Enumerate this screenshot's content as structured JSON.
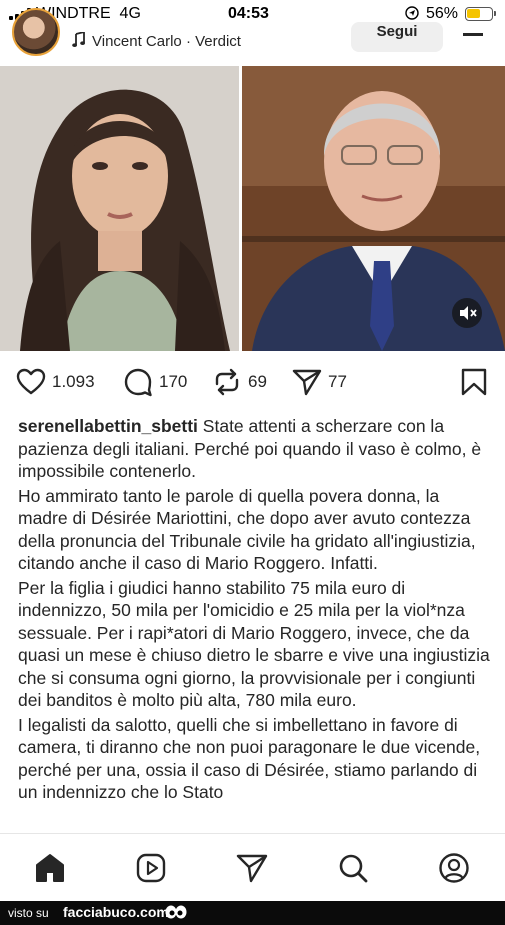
{
  "status_bar": {
    "carrier": "WINDTRE",
    "network": "4G",
    "time": "04:53",
    "battery": "56%",
    "battery_level": 0.56,
    "battery_color": "#f5c400"
  },
  "post": {
    "audio_label": "Vincent Carlo · Verdict",
    "follow_label": "Segui",
    "avatar_ring_color": "#e8a23a"
  },
  "actions": {
    "likes": "1.093",
    "comments": "170",
    "reposts": "69",
    "shares": "77"
  },
  "caption": {
    "username": "serenellabettin_sbetti",
    "paragraphs": [
      "State attenti a scherzare con la pazienza degli italiani. Perché poi quando il vaso è colmo, è impossibile contenerlo.",
      "Ho ammirato tanto le parole di quella povera donna, la madre di Désirée Mariottini, che dopo aver avuto contezza della pronuncia del Tribunale civile ha gridato all'ingiustizia, citando anche il caso di Mario Roggero. Infatti.",
      "Per la figlia i giudici hanno stabilito 75 mila  euro di indennizzo, 50 mila per l'omicidio e 25 mila per la viol*nza sessuale. Per i rapi*atori di Mario Roggero, invece, che da quasi un mese è chiuso dietro le sbarre e vive una ingiustizia che si consuma ogni giorno, la provvisionale per i congiunti dei banditos è molto più alta, 780 mila euro.",
      "I legalisti da salotto, quelli che si imbellettano in favore di camera, ti diranno che non puoi paragonare le due vicende, perché per una, ossia il caso di Désirée, stiamo parlando di un indennizzo che lo Stato"
    ]
  },
  "nav": {
    "items": [
      "home-icon",
      "reels-icon",
      "direct-icon",
      "search-icon",
      "profile-icon"
    ]
  },
  "watermark": {
    "prefix": "visto su",
    "site": "facciabuco.com"
  }
}
